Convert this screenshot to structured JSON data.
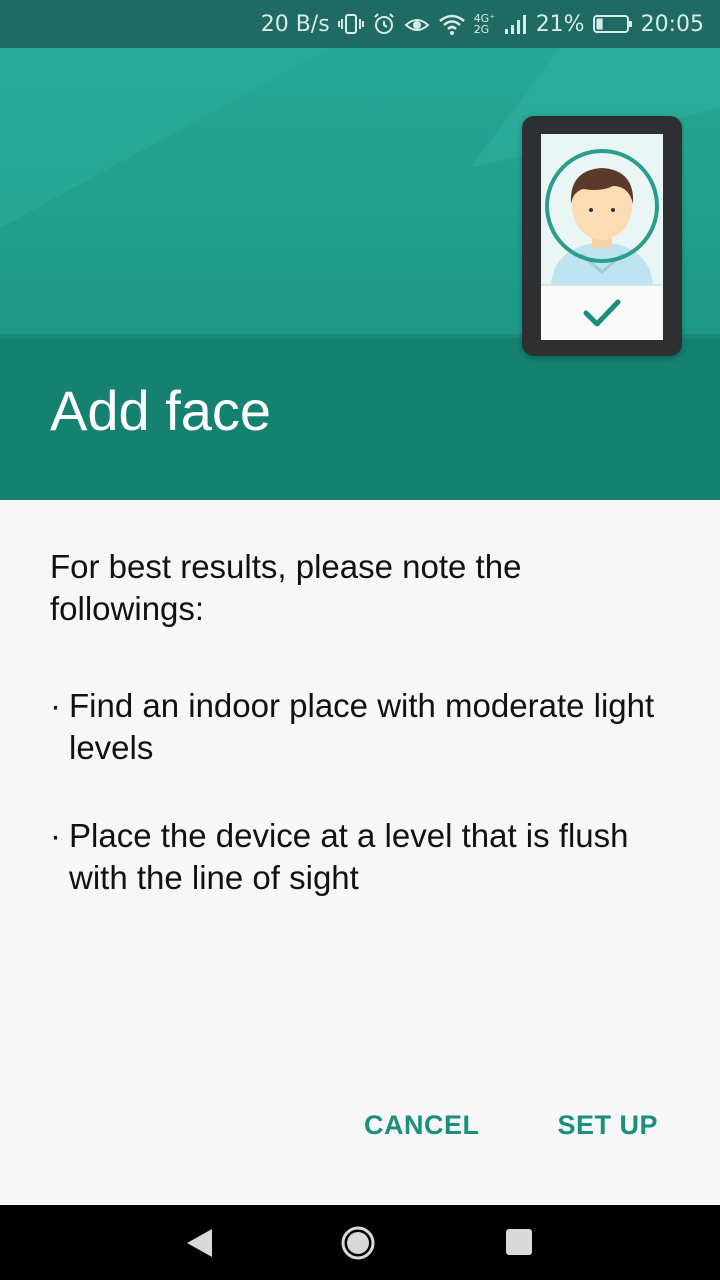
{
  "status_bar": {
    "net_speed": "20 B/s",
    "network_types": "4G⁺ 2G",
    "battery_percent": "21%",
    "time": "20:05",
    "battery_level": 0.21,
    "icons": [
      "vibrate-icon",
      "alarm-icon",
      "eye-comfort-icon",
      "wifi-icon",
      "signal-icon",
      "battery-icon"
    ]
  },
  "header": {
    "title": "Add face",
    "illustration": "phone-face-check-icon"
  },
  "content": {
    "intro": "For best results, please note the followings:",
    "bullets": [
      {
        "marker": "·",
        "text": "Find an indoor place with moderate light levels"
      },
      {
        "marker": "·",
        "text": "Place the device at a level that is flush with the line of sight"
      }
    ]
  },
  "actions": {
    "cancel_label": "CANCEL",
    "setup_label": "SET UP"
  },
  "navbar": {
    "icons": [
      "back-icon",
      "home-icon",
      "recents-icon"
    ]
  },
  "colors": {
    "accent": "#1a8f7e",
    "header": "#1f9a89",
    "status_bar": "#1f6b63"
  }
}
